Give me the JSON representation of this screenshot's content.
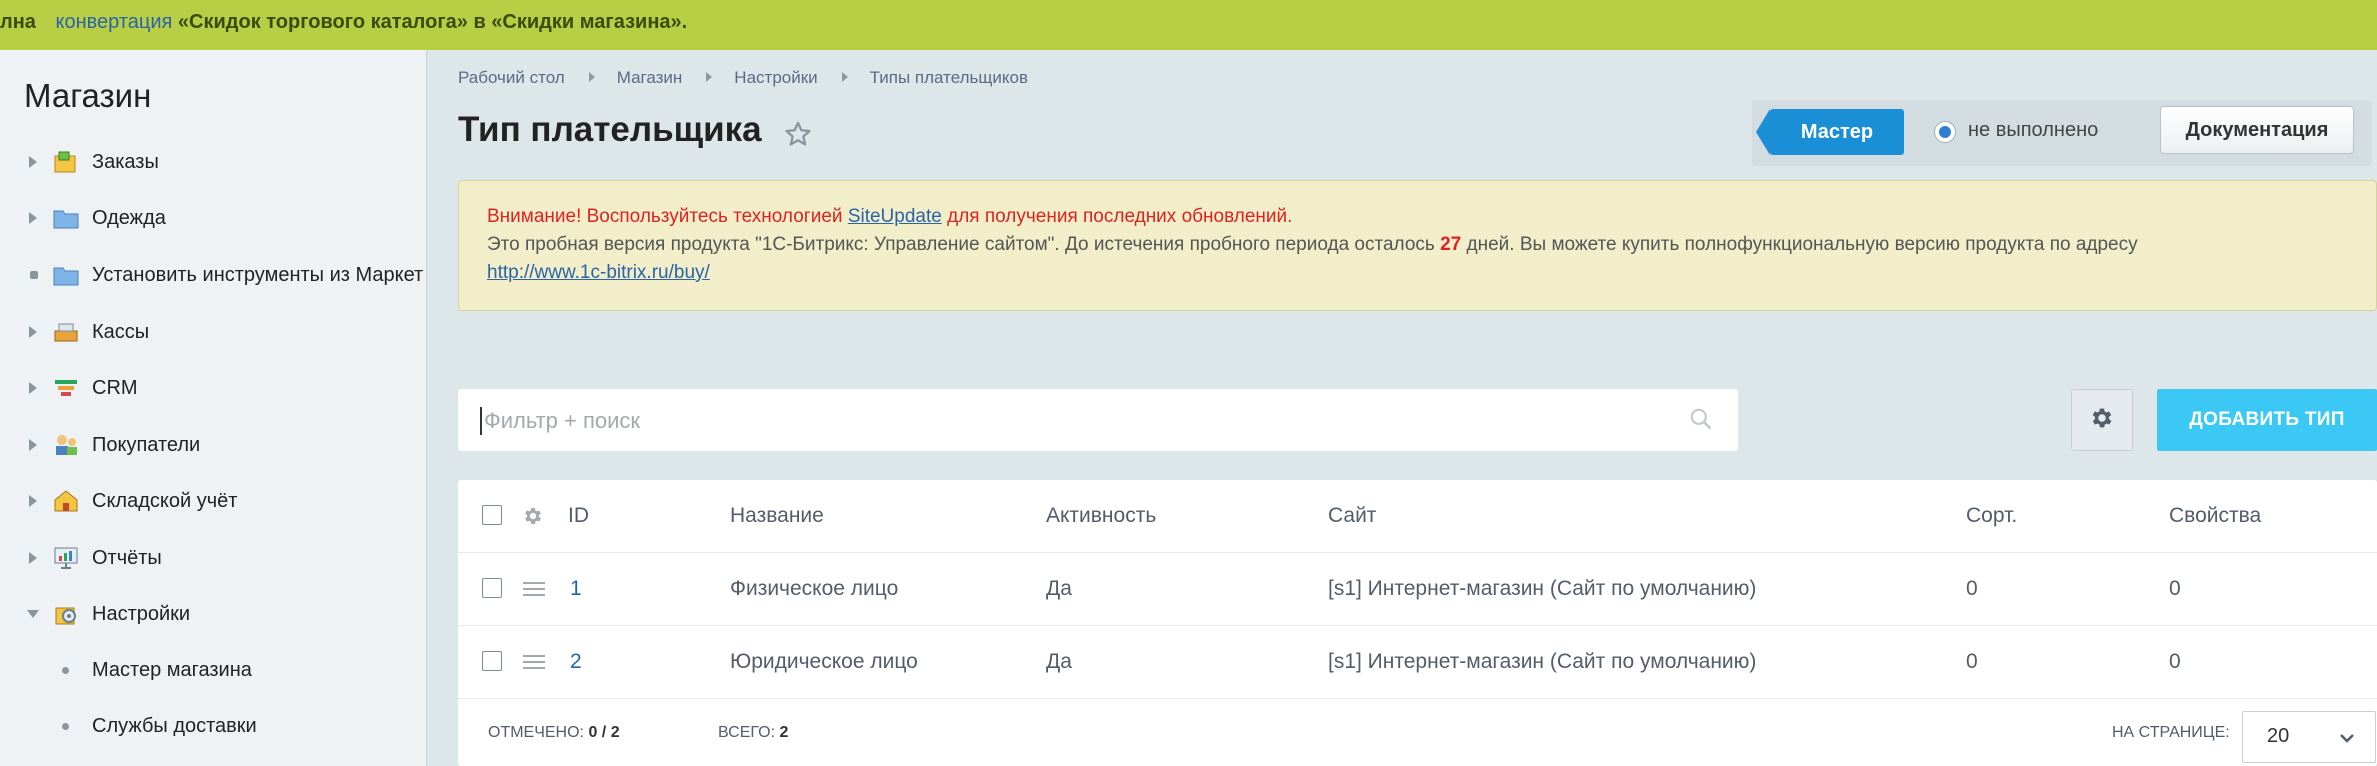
{
  "topbar": {
    "prefix": "лна",
    "link": "конвертация",
    "rest": "«Скидок торгового каталога» в «Скидки магазина»."
  },
  "sidebar": {
    "title": "Магазин",
    "items": [
      {
        "label": "Заказы",
        "icon": "orders-icon",
        "state": "collapsed"
      },
      {
        "label": "Одежда",
        "icon": "folder-icon",
        "state": "collapsed"
      },
      {
        "label": "Установить инструменты из Маркет",
        "icon": "folder-icon",
        "state": "leaf"
      },
      {
        "label": "Кассы",
        "icon": "cash-register-icon",
        "state": "collapsed"
      },
      {
        "label": "CRM",
        "icon": "crm-funnel-icon",
        "state": "collapsed"
      },
      {
        "label": "Покупатели",
        "icon": "customers-icon",
        "state": "collapsed"
      },
      {
        "label": "Складской учёт",
        "icon": "warehouse-icon",
        "state": "collapsed"
      },
      {
        "label": "Отчёты",
        "icon": "reports-icon",
        "state": "collapsed"
      },
      {
        "label": "Настройки",
        "icon": "settings-icon",
        "state": "expanded"
      }
    ],
    "subitems": [
      {
        "label": "Мастер магазина"
      },
      {
        "label": "Службы доставки"
      }
    ]
  },
  "breadcrumb": [
    "Рабочий стол",
    "Магазин",
    "Настройки",
    "Типы плательщиков"
  ],
  "page": {
    "title": "Тип плательщика"
  },
  "master": {
    "button": "Мастер",
    "status": "не выполнено",
    "docs": "Документация"
  },
  "notice": {
    "warn_prefix": "Внимание! Воспользуйтесь технологией",
    "warn_link": "SiteUpdate",
    "warn_suffix": "для получения последних обновлений.",
    "trial_text": "Это пробная версия продукта \"1С-Битрикс: Управление сайтом\". До истечения пробного периода осталось",
    "days": "27",
    "trial_text2": "дней. Вы можете купить полнофункциональную версию продукта по адресу",
    "url": "http://www.1c-bitrix.ru/buy/"
  },
  "filter": {
    "placeholder": "Фильтр + поиск"
  },
  "toolbar": {
    "add_label": "ДОБАВИТЬ ТИП"
  },
  "table": {
    "columns": [
      "ID",
      "Название",
      "Активность",
      "Сайт",
      "Сорт.",
      "Свойства"
    ],
    "rows": [
      {
        "id": "1",
        "name": "Физическое лицо",
        "active": "Да",
        "site": "[s1] Интернет-магазин (Сайт по умолчанию)",
        "sort": "0",
        "props": "0"
      },
      {
        "id": "2",
        "name": "Юридическое лицо",
        "active": "Да",
        "site": "[s1] Интернет-магазин (Сайт по умолчанию)",
        "sort": "0",
        "props": "0"
      }
    ]
  },
  "footer": {
    "selected_label": "ОТМЕЧЕНО:",
    "selected_value": "0 / 2",
    "total_label": "ВСЕГО:",
    "total_value": "2",
    "per_page_label": "НА СТРАНИЦЕ:",
    "per_page_value": "20"
  },
  "colors": {
    "topbar": "#b7ce45",
    "accent": "#3bc8f5",
    "master": "#1b8fd6",
    "warning": "#e02222"
  }
}
